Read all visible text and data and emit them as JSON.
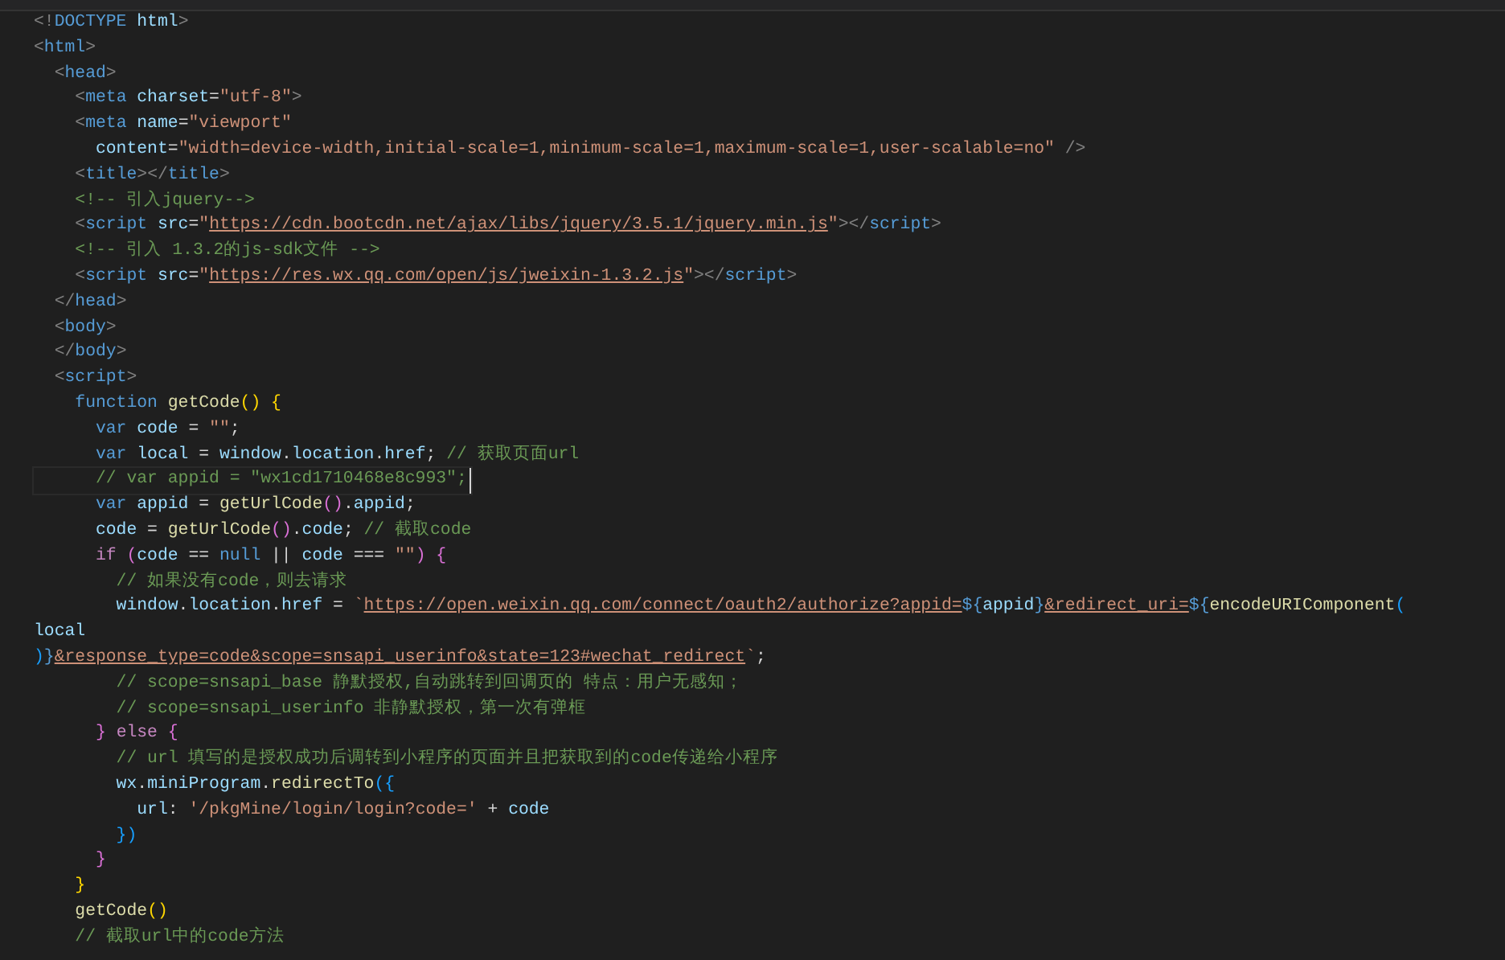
{
  "lines": [
    {
      "current": false,
      "tokens": [
        {
          "kind": "punct",
          "text": "<!"
        },
        {
          "kind": "tag",
          "text": "DOCTYPE"
        },
        {
          "kind": "attr",
          "text": " html"
        },
        {
          "kind": "punct",
          "text": ">"
        }
      ]
    },
    {
      "current": false,
      "tokens": [
        {
          "kind": "punct",
          "text": "<"
        },
        {
          "kind": "tag",
          "text": "html"
        },
        {
          "kind": "punct",
          "text": ">"
        }
      ]
    },
    {
      "current": false,
      "tokens": [
        {
          "kind": "punct",
          "text": "  <"
        },
        {
          "kind": "tag",
          "text": "head"
        },
        {
          "kind": "punct",
          "text": ">"
        }
      ]
    },
    {
      "current": false,
      "tokens": [
        {
          "kind": "punct",
          "text": "    <"
        },
        {
          "kind": "tag",
          "text": "meta"
        },
        {
          "kind": "attr",
          "text": " charset"
        },
        {
          "kind": "text",
          "text": "="
        },
        {
          "kind": "string",
          "text": "\"utf-8\""
        },
        {
          "kind": "punct",
          "text": ">"
        }
      ]
    },
    {
      "current": false,
      "tokens": [
        {
          "kind": "punct",
          "text": "    <"
        },
        {
          "kind": "tag",
          "text": "meta"
        },
        {
          "kind": "attr",
          "text": " name"
        },
        {
          "kind": "text",
          "text": "="
        },
        {
          "kind": "string",
          "text": "\"viewport\""
        }
      ]
    },
    {
      "current": false,
      "tokens": [
        {
          "kind": "attr",
          "text": "      content"
        },
        {
          "kind": "text",
          "text": "="
        },
        {
          "kind": "string",
          "text": "\"width=device-width,initial-scale=1,minimum-scale=1,maximum-scale=1,user-scalable=no\""
        },
        {
          "kind": "punct",
          "text": " />"
        }
      ]
    },
    {
      "current": false,
      "tokens": [
        {
          "kind": "punct",
          "text": "    <"
        },
        {
          "kind": "tag",
          "text": "title"
        },
        {
          "kind": "punct",
          "text": "></"
        },
        {
          "kind": "tag",
          "text": "title"
        },
        {
          "kind": "punct",
          "text": ">"
        }
      ]
    },
    {
      "current": false,
      "tokens": [
        {
          "kind": "comment",
          "text": "    <!-- 引入jquery-->"
        }
      ]
    },
    {
      "current": false,
      "tokens": [
        {
          "kind": "punct",
          "text": "    <"
        },
        {
          "kind": "tag",
          "text": "script"
        },
        {
          "kind": "attr",
          "text": " src"
        },
        {
          "kind": "text",
          "text": "="
        },
        {
          "kind": "string",
          "text": "\""
        },
        {
          "kind": "link",
          "text": "https://cdn.bootcdn.net/ajax/libs/jquery/3.5.1/jquery.min.js"
        },
        {
          "kind": "string",
          "text": "\""
        },
        {
          "kind": "punct",
          "text": "></"
        },
        {
          "kind": "tag",
          "text": "script"
        },
        {
          "kind": "punct",
          "text": ">"
        }
      ]
    },
    {
      "current": false,
      "tokens": [
        {
          "kind": "comment",
          "text": "    <!-- 引入 1.3.2的js-sdk文件 -->"
        }
      ]
    },
    {
      "current": false,
      "tokens": [
        {
          "kind": "punct",
          "text": "    <"
        },
        {
          "kind": "tag",
          "text": "script"
        },
        {
          "kind": "attr",
          "text": " src"
        },
        {
          "kind": "text",
          "text": "="
        },
        {
          "kind": "string",
          "text": "\""
        },
        {
          "kind": "link",
          "text": "https://res.wx.qq.com/open/js/jweixin-1.3.2.js"
        },
        {
          "kind": "string",
          "text": "\""
        },
        {
          "kind": "punct",
          "text": "></"
        },
        {
          "kind": "tag",
          "text": "script"
        },
        {
          "kind": "punct",
          "text": ">"
        }
      ]
    },
    {
      "current": false,
      "tokens": [
        {
          "kind": "punct",
          "text": "  </"
        },
        {
          "kind": "tag",
          "text": "head"
        },
        {
          "kind": "punct",
          "text": ">"
        }
      ]
    },
    {
      "current": false,
      "tokens": [
        {
          "kind": "punct",
          "text": "  <"
        },
        {
          "kind": "tag",
          "text": "body"
        },
        {
          "kind": "punct",
          "text": ">"
        }
      ]
    },
    {
      "current": false,
      "tokens": [
        {
          "kind": "punct",
          "text": "  </"
        },
        {
          "kind": "tag",
          "text": "body"
        },
        {
          "kind": "punct",
          "text": ">"
        }
      ]
    },
    {
      "current": false,
      "tokens": [
        {
          "kind": "punct",
          "text": "  <"
        },
        {
          "kind": "tag",
          "text": "script"
        },
        {
          "kind": "punct",
          "text": ">"
        }
      ]
    },
    {
      "current": false,
      "tokens": [
        {
          "kind": "keyword",
          "text": "    function"
        },
        {
          "kind": "function",
          "text": " getCode"
        },
        {
          "kind": "bracket",
          "text": "()"
        },
        {
          "kind": "bracket",
          "text": " {"
        }
      ]
    },
    {
      "current": false,
      "tokens": [
        {
          "kind": "keyword",
          "text": "      var"
        },
        {
          "kind": "variable",
          "text": " code"
        },
        {
          "kind": "text",
          "text": " = "
        },
        {
          "kind": "string",
          "text": "\"\""
        },
        {
          "kind": "text",
          "text": ";"
        }
      ]
    },
    {
      "current": false,
      "tokens": [
        {
          "kind": "keyword",
          "text": "      var"
        },
        {
          "kind": "variable",
          "text": " local"
        },
        {
          "kind": "text",
          "text": " = "
        },
        {
          "kind": "variable",
          "text": "window"
        },
        {
          "kind": "text",
          "text": "."
        },
        {
          "kind": "variable",
          "text": "location"
        },
        {
          "kind": "text",
          "text": "."
        },
        {
          "kind": "variable",
          "text": "href"
        },
        {
          "kind": "text",
          "text": "; "
        },
        {
          "kind": "comment",
          "text": "// 获取页面url"
        }
      ]
    },
    {
      "current": true,
      "tokens": [
        {
          "kind": "comment",
          "text": "      // var appid = \"wx1cd1710468e8c993\";"
        }
      ]
    },
    {
      "current": false,
      "tokens": [
        {
          "kind": "keyword",
          "text": "      var"
        },
        {
          "kind": "variable",
          "text": " appid"
        },
        {
          "kind": "text",
          "text": " = "
        },
        {
          "kind": "function",
          "text": "getUrlCode"
        },
        {
          "kind": "bracket2",
          "text": "()"
        },
        {
          "kind": "text",
          "text": "."
        },
        {
          "kind": "variable",
          "text": "appid"
        },
        {
          "kind": "text",
          "text": ";"
        }
      ]
    },
    {
      "current": false,
      "tokens": [
        {
          "kind": "variable",
          "text": "      code"
        },
        {
          "kind": "text",
          "text": " = "
        },
        {
          "kind": "function",
          "text": "getUrlCode"
        },
        {
          "kind": "bracket2",
          "text": "()"
        },
        {
          "kind": "text",
          "text": "."
        },
        {
          "kind": "variable",
          "text": "code"
        },
        {
          "kind": "text",
          "text": "; "
        },
        {
          "kind": "comment",
          "text": "// 截取code"
        }
      ]
    },
    {
      "current": false,
      "tokens": [
        {
          "kind": "control",
          "text": "      if"
        },
        {
          "kind": "bracket2",
          "text": " ("
        },
        {
          "kind": "variable",
          "text": "code"
        },
        {
          "kind": "text",
          "text": " == "
        },
        {
          "kind": "keyword",
          "text": "null"
        },
        {
          "kind": "text",
          "text": " || "
        },
        {
          "kind": "variable",
          "text": "code"
        },
        {
          "kind": "text",
          "text": " === "
        },
        {
          "kind": "string",
          "text": "\"\""
        },
        {
          "kind": "bracket2",
          "text": ") {"
        }
      ]
    },
    {
      "current": false,
      "tokens": [
        {
          "kind": "comment",
          "text": "        // 如果没有code，则去请求"
        }
      ]
    },
    {
      "current": false,
      "tokens": [
        {
          "kind": "variable",
          "text": "        window"
        },
        {
          "kind": "text",
          "text": "."
        },
        {
          "kind": "variable",
          "text": "location"
        },
        {
          "kind": "text",
          "text": "."
        },
        {
          "kind": "variable",
          "text": "href"
        },
        {
          "kind": "text",
          "text": " = "
        },
        {
          "kind": "string",
          "text": "`"
        },
        {
          "kind": "link",
          "text": "https://open.weixin.qq.com/connect/oauth2/authorize?appid="
        },
        {
          "kind": "template",
          "text": "${"
        },
        {
          "kind": "variable",
          "text": "appid"
        },
        {
          "kind": "template",
          "text": "}"
        },
        {
          "kind": "link",
          "text": "&redirect_uri="
        },
        {
          "kind": "template",
          "text": "${"
        },
        {
          "kind": "function",
          "text": "encodeURIComponent"
        },
        {
          "kind": "bracket3",
          "text": "("
        }
      ]
    },
    {
      "current": false,
      "tokens": [
        {
          "kind": "variable",
          "text": "local"
        }
      ]
    },
    {
      "current": false,
      "tokens": [
        {
          "kind": "bracket3",
          "text": ")"
        },
        {
          "kind": "template",
          "text": "}"
        },
        {
          "kind": "link",
          "text": "&response_type=code&scope=snsapi_userinfo&state=123#wechat_redirect"
        },
        {
          "kind": "string",
          "text": "`"
        },
        {
          "kind": "text",
          "text": ";"
        }
      ]
    },
    {
      "current": false,
      "tokens": [
        {
          "kind": "comment",
          "text": "        // scope=snsapi_base 静默授权,自动跳转到回调页的 特点：用户无感知；"
        }
      ]
    },
    {
      "current": false,
      "tokens": [
        {
          "kind": "comment",
          "text": "        // scope=snsapi_userinfo 非静默授权，第一次有弹框"
        }
      ]
    },
    {
      "current": false,
      "tokens": [
        {
          "kind": "bracket2",
          "text": "      }"
        },
        {
          "kind": "control",
          "text": " else"
        },
        {
          "kind": "bracket2",
          "text": " {"
        }
      ]
    },
    {
      "current": false,
      "tokens": [
        {
          "kind": "comment",
          "text": "        // url 填写的是授权成功后调转到小程序的页面并且把获取到的code传递给小程序"
        }
      ]
    },
    {
      "current": false,
      "tokens": [
        {
          "kind": "variable",
          "text": "        wx"
        },
        {
          "kind": "text",
          "text": "."
        },
        {
          "kind": "variable",
          "text": "miniProgram"
        },
        {
          "kind": "text",
          "text": "."
        },
        {
          "kind": "function",
          "text": "redirectTo"
        },
        {
          "kind": "bracket3",
          "text": "({"
        }
      ]
    },
    {
      "current": false,
      "tokens": [
        {
          "kind": "variable",
          "text": "          url"
        },
        {
          "kind": "text",
          "text": ": "
        },
        {
          "kind": "string",
          "text": "'/pkgMine/login/login?code='"
        },
        {
          "kind": "text",
          "text": " + "
        },
        {
          "kind": "variable",
          "text": "code"
        }
      ]
    },
    {
      "current": false,
      "tokens": [
        {
          "kind": "bracket3",
          "text": "        })"
        }
      ]
    },
    {
      "current": false,
      "tokens": [
        {
          "kind": "bracket2",
          "text": "      }"
        }
      ]
    },
    {
      "current": false,
      "tokens": [
        {
          "kind": "bracket",
          "text": "    }"
        }
      ]
    },
    {
      "current": false,
      "tokens": [
        {
          "kind": "function",
          "text": "    getCode"
        },
        {
          "kind": "bracket",
          "text": "()"
        }
      ]
    },
    {
      "current": false,
      "tokens": [
        {
          "kind": "comment",
          "text": "    // 截取url中的code方法"
        }
      ]
    }
  ]
}
